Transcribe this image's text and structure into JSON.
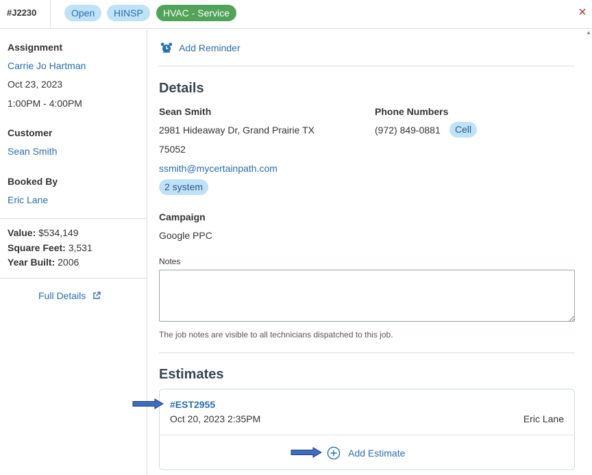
{
  "header": {
    "job_id": "#J2230",
    "status": "Open",
    "tag": "HINSP",
    "job_type": "HVAC - Service",
    "close_glyph": "×"
  },
  "sidebar": {
    "assignment_label": "Assignment",
    "assignee": "Carrie Jo Hartman",
    "date": "Oct 23, 2023",
    "time_window": "1:00PM - 4:00PM",
    "customer_label": "Customer",
    "customer_name": "Sean Smith",
    "booked_by_label": "Booked By",
    "booked_by": "Eric Lane",
    "value_label": "Value:",
    "value": "$534,149",
    "sqft_label": "Square Feet:",
    "sqft": "3,531",
    "year_label": "Year Built:",
    "year": "2006",
    "full_details": "Full Details"
  },
  "main": {
    "add_reminder": "Add Reminder",
    "details_title": "Details",
    "customer_name": "Sean Smith",
    "address_line1": "2981 Hideaway Dr, Grand Prairie TX",
    "address_line2": "75052",
    "email": "ssmith@mycertainpath.com",
    "systems_badge": "2 system",
    "phone_label": "Phone Numbers",
    "phone": "(972) 849-0881",
    "phone_type": "Cell",
    "campaign_label": "Campaign",
    "campaign": "Google PPC",
    "notes_label": "Notes",
    "notes_value": "",
    "notes_help": "The job notes are visible to all technicians dispatched to this job.",
    "estimates_title": "Estimates",
    "estimate": {
      "id": "#EST2955",
      "date": "Oct 20, 2023 2:35PM",
      "created_by": "Eric Lane"
    },
    "add_estimate": "Add Estimate"
  },
  "icons": {
    "reminder": "alarm-clock-icon",
    "external": "external-link-icon",
    "add": "plus-circle-icon",
    "close": "close-icon"
  },
  "colors": {
    "link": "#2a6db0",
    "pill_blue": "#bfe2f7",
    "pill_green": "#52a35a",
    "close_red": "#c23030",
    "arrow": "#3f6cc0"
  }
}
